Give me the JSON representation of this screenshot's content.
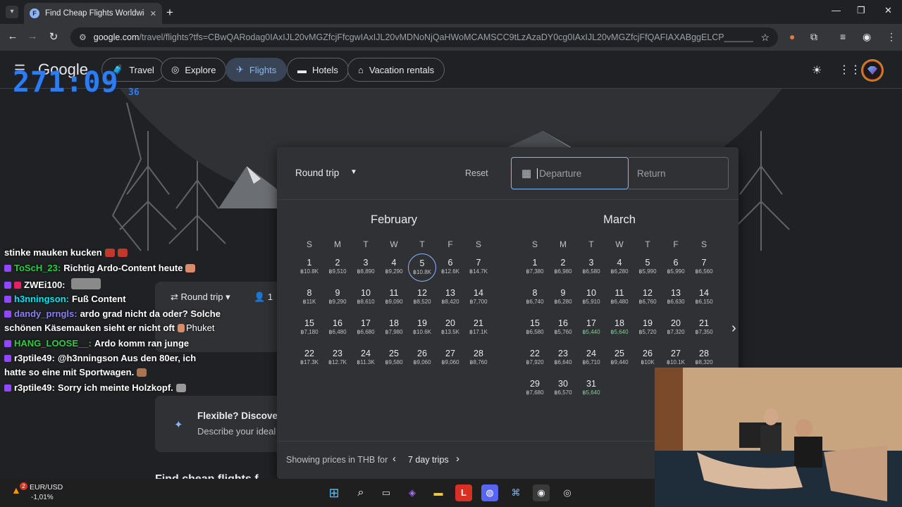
{
  "browser": {
    "tab_title": "Find Cheap Flights Worldwide & Trac",
    "tab_favicon": "F",
    "url_host": "google.com",
    "url_rest": "/travel/flights?tfs=CBwQARodag0IAxIJL20vMGZfcjFfcgwIAxIJL20vMDNoNjQaHWoMCAMSCC9tLzAzaDY0cg0IAxIJL20vMGZfcjFfQAFIAXABggELCP________wGYAQE&tfu..."
  },
  "appbar": {
    "logo": "Google",
    "nav": [
      {
        "label": "Travel",
        "icon": "travel-icon"
      },
      {
        "label": "Explore",
        "icon": "explore-icon"
      },
      {
        "label": "Flights",
        "icon": "plane-icon"
      },
      {
        "label": "Hotels",
        "icon": "bed-icon"
      },
      {
        "label": "Vacation rentals",
        "icon": "house-icon"
      }
    ]
  },
  "overlay": {
    "timer": "271:09",
    "timer_sub": "36"
  },
  "chat": [
    {
      "user": "",
      "text": "stinke mauken kucken",
      "color": "#ffffff"
    },
    {
      "user": "ToScH_23:",
      "text": "Richtig Ardo-Content heute",
      "color": "#2ecc40"
    },
    {
      "user": "ZWEi100:",
      "text": "",
      "color": "#ffffff"
    },
    {
      "user": "h3nningson:",
      "text": "Fuß Content",
      "color": "#00e5ff"
    },
    {
      "user": "dandy_prngls:",
      "text": "ardo grad nicht da oder? Solche",
      "color": "#8a7dff"
    },
    {
      "user": "",
      "text": "schönen Käsemauken sieht er nicht oft",
      "color": "#ffffff"
    },
    {
      "user": "HANG_LOOSE__:",
      "text": "Ardo komm ran junge",
      "color": "#2ecc40"
    },
    {
      "user": "r3ptile49:",
      "text": "@h3nningson Aus den 80er, ich",
      "color": "#ffffff"
    },
    {
      "user": "",
      "text": "hatte so eine mit Sportwagen.",
      "color": "#ffffff"
    },
    {
      "user": "r3ptile49:",
      "text": "Sorry ich meinte Holzkopf.",
      "color": "#ffffff"
    }
  ],
  "search": {
    "trip_type": "Round trip",
    "passengers": "1",
    "from_text": "Phuket",
    "flex_title": "Flexible? Discover",
    "flex_sub": "Describe your ideal",
    "find_cheap": "Find cheap flights f"
  },
  "picker": {
    "trip_type": "Round trip",
    "reset": "Reset",
    "departure_placeholder": "Departure",
    "return_placeholder": "Return",
    "weekdays": [
      "S",
      "M",
      "T",
      "W",
      "T",
      "F",
      "S"
    ],
    "months": [
      {
        "name": "February",
        "start_weekday": 0,
        "days": [
          {
            "d": "1",
            "p": "฿10.8K"
          },
          {
            "d": "2",
            "p": "฿9,510"
          },
          {
            "d": "3",
            "p": "฿8,890"
          },
          {
            "d": "4",
            "p": "฿9,290"
          },
          {
            "d": "5",
            "p": "฿10.8K",
            "sel": true
          },
          {
            "d": "6",
            "p": "฿12.6K"
          },
          {
            "d": "7",
            "p": "฿14.7K"
          },
          {
            "d": "8",
            "p": "฿11K"
          },
          {
            "d": "9",
            "p": "฿9,290"
          },
          {
            "d": "10",
            "p": "฿8,610"
          },
          {
            "d": "11",
            "p": "฿9,090"
          },
          {
            "d": "12",
            "p": "฿8,520"
          },
          {
            "d": "13",
            "p": "฿8,420"
          },
          {
            "d": "14",
            "p": "฿7,700"
          },
          {
            "d": "15",
            "p": "฿7,180"
          },
          {
            "d": "16",
            "p": "฿6,480"
          },
          {
            "d": "17",
            "p": "฿6,680"
          },
          {
            "d": "18",
            "p": "฿7,980"
          },
          {
            "d": "19",
            "p": "฿10.6K"
          },
          {
            "d": "20",
            "p": "฿13.5K"
          },
          {
            "d": "21",
            "p": "฿17.1K"
          },
          {
            "d": "22",
            "p": "฿17.3K"
          },
          {
            "d": "23",
            "p": "฿12.7K"
          },
          {
            "d": "24",
            "p": "฿11.3K"
          },
          {
            "d": "25",
            "p": "฿9,580"
          },
          {
            "d": "26",
            "p": "฿9,060"
          },
          {
            "d": "27",
            "p": "฿9,060"
          },
          {
            "d": "28",
            "p": "฿8,760"
          }
        ]
      },
      {
        "name": "March",
        "start_weekday": 0,
        "days": [
          {
            "d": "1",
            "p": "฿7,380"
          },
          {
            "d": "2",
            "p": "฿6,980"
          },
          {
            "d": "3",
            "p": "฿6,580"
          },
          {
            "d": "4",
            "p": "฿6,280"
          },
          {
            "d": "5",
            "p": "฿5,990"
          },
          {
            "d": "6",
            "p": "฿5,990"
          },
          {
            "d": "7",
            "p": "฿6,560"
          },
          {
            "d": "8",
            "p": "฿6,740"
          },
          {
            "d": "9",
            "p": "฿6,280"
          },
          {
            "d": "10",
            "p": "฿5,910"
          },
          {
            "d": "11",
            "p": "฿6,480"
          },
          {
            "d": "12",
            "p": "฿6,760"
          },
          {
            "d": "13",
            "p": "฿6,630"
          },
          {
            "d": "14",
            "p": "฿6,150"
          },
          {
            "d": "15",
            "p": "฿6,580"
          },
          {
            "d": "16",
            "p": "฿5,760"
          },
          {
            "d": "17",
            "p": "฿5,440",
            "cheap": true
          },
          {
            "d": "18",
            "p": "฿5,640",
            "cheap": true
          },
          {
            "d": "19",
            "p": "฿5,720"
          },
          {
            "d": "20",
            "p": "฿7,320"
          },
          {
            "d": "21",
            "p": "฿7,350"
          },
          {
            "d": "22",
            "p": "฿7,920"
          },
          {
            "d": "23",
            "p": "฿6,640"
          },
          {
            "d": "24",
            "p": "฿6,710"
          },
          {
            "d": "25",
            "p": "฿9,440"
          },
          {
            "d": "26",
            "p": "฿10K"
          },
          {
            "d": "27",
            "p": "฿10.1K"
          },
          {
            "d": "28",
            "p": "฿8,320"
          },
          {
            "d": "29",
            "p": "฿7,680"
          },
          {
            "d": "30",
            "p": "฿6,570"
          },
          {
            "d": "31",
            "p": "฿5,640",
            "cheap": true
          }
        ]
      }
    ],
    "showing_label": "Showing prices in THB for",
    "trip_length": "7 day trips"
  },
  "taskbar": {
    "fx_pair": "EUR/USD",
    "fx_change": "-1,01%",
    "fx_badge": "2",
    "apps": [
      "windows-icon",
      "search-icon",
      "task-view-icon",
      "copilot-icon",
      "file-explorer-icon",
      "app-l-icon",
      "discord-icon",
      "network-app-icon",
      "chrome-icon",
      "obs-icon"
    ]
  },
  "colors": {
    "accent": "#8ab4f8",
    "cheap_price": "#81c995",
    "timer": "#2d7cf2"
  }
}
